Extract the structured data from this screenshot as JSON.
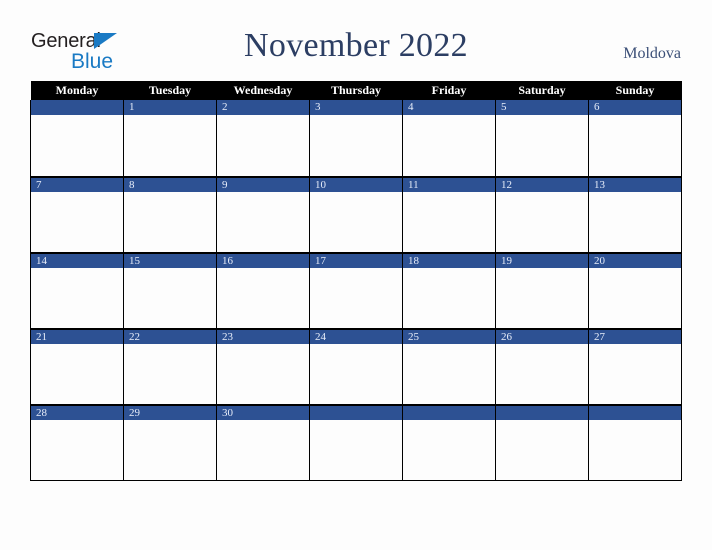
{
  "brand": {
    "name_part1": "General",
    "name_part2": "Blue",
    "triangle_color": "#1a7ac4"
  },
  "header": {
    "title": "November 2022",
    "region": "Moldova"
  },
  "colors": {
    "day_band": "#2d5193",
    "header_row": "#000000",
    "title_text": "#2c3e63",
    "region_text": "#3b4f77",
    "page_background": "#fdfdfd",
    "grid_line": "#000000"
  },
  "calendar": {
    "month": "November",
    "year": "2022",
    "weekday_headers": [
      "Monday",
      "Tuesday",
      "Wednesday",
      "Thursday",
      "Friday",
      "Saturday",
      "Sunday"
    ],
    "weeks": [
      [
        {
          "day": ""
        },
        {
          "day": "1"
        },
        {
          "day": "2"
        },
        {
          "day": "3"
        },
        {
          "day": "4"
        },
        {
          "day": "5"
        },
        {
          "day": "6"
        }
      ],
      [
        {
          "day": "7"
        },
        {
          "day": "8"
        },
        {
          "day": "9"
        },
        {
          "day": "10"
        },
        {
          "day": "11"
        },
        {
          "day": "12"
        },
        {
          "day": "13"
        }
      ],
      [
        {
          "day": "14"
        },
        {
          "day": "15"
        },
        {
          "day": "16"
        },
        {
          "day": "17"
        },
        {
          "day": "18"
        },
        {
          "day": "19"
        },
        {
          "day": "20"
        }
      ],
      [
        {
          "day": "21"
        },
        {
          "day": "22"
        },
        {
          "day": "23"
        },
        {
          "day": "24"
        },
        {
          "day": "25"
        },
        {
          "day": "26"
        },
        {
          "day": "27"
        }
      ],
      [
        {
          "day": "28"
        },
        {
          "day": "29"
        },
        {
          "day": "30"
        },
        {
          "day": ""
        },
        {
          "day": ""
        },
        {
          "day": ""
        },
        {
          "day": ""
        }
      ]
    ]
  }
}
